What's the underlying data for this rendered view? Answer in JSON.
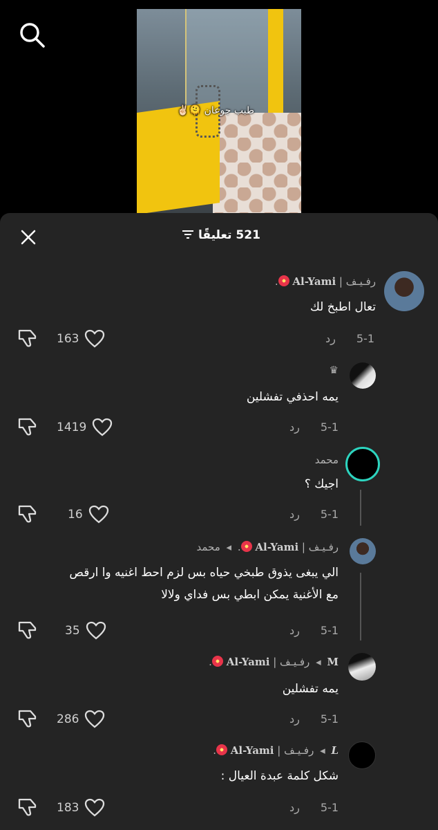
{
  "video": {
    "caption": "طبب جوعان 🫠✌🏻"
  },
  "sheet": {
    "title": "521 تعليقًا"
  },
  "comments": [
    {
      "user_prefix": "رفـيـف | ",
      "user_main": "Al-Yami",
      "user_suffix": ".",
      "text": "تعال اطبخ لك",
      "date": "5-1",
      "reply": "رد",
      "likes": "163"
    },
    {
      "user": "♛",
      "text": "يمه احذفي تفشلين",
      "date": "5-1",
      "reply": "رد",
      "likes": "1419"
    },
    {
      "user": "محمد",
      "text": "اجيك ؟",
      "date": "5-1",
      "reply": "رد",
      "likes": "16"
    },
    {
      "user_prefix": "رفـيـف | ",
      "user_main": "Al-Yami",
      "user_suffix": ".",
      "reply_to": "محمد",
      "text_line1": "الي يبغى يذوق طبخي حياه بس لزم احط اغنيه وا ارقص",
      "text_line2": "مع الأغنية يمكن ابطي بس فداي ولالا",
      "date": "5-1",
      "reply": "رد",
      "likes": "35"
    },
    {
      "user_from": "M",
      "user_prefix": "رفـيـف | ",
      "user_main": "Al-Yami",
      "user_suffix": ".",
      "text": "يمه تفشلين",
      "date": "5-1",
      "reply": "رد",
      "likes": "286"
    },
    {
      "user_from": "L",
      "user_prefix": "رفـيـف | ",
      "user_main": "Al-Yami",
      "user_suffix": ".",
      "text": "شكل كلمة عبدة العيال :",
      "date": "5-1",
      "reply": "رد",
      "likes": "183"
    }
  ],
  "icons": {
    "search": "search-icon",
    "close": "close-icon",
    "filter": "filter-icon",
    "heart": "heart-icon",
    "dislike": "thumbs-down-icon"
  },
  "colors": {
    "sheet_bg": "#242424",
    "page_bg": "#000000"
  }
}
